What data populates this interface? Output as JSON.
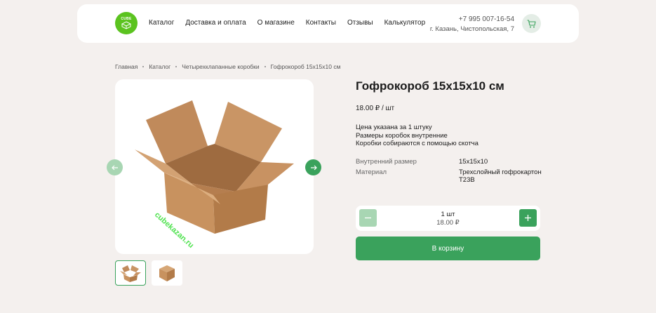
{
  "header": {
    "logo_text": "CUBE",
    "nav": [
      "Каталог",
      "Доставка и оплата",
      "О магазине",
      "Контакты",
      "Отзывы",
      "Калькулятор"
    ],
    "phone": "+7 995 007-16-54",
    "address": "г. Казань, Чистопольская, 7"
  },
  "breadcrumb": [
    "Главная",
    "Каталог",
    "Четырехклапанные коробки",
    "Гофрокороб 15х15х10 см"
  ],
  "product": {
    "title": "Гофрокороб 15х15х10 см",
    "price": "18.00 ₽ / шт",
    "description": [
      "Цена указана за 1 штуку",
      "Размеры коробок внутренние",
      "Коробки собираются с помощью скотча"
    ],
    "specs": [
      {
        "label": "Внутренний размер",
        "value": "15х15х10"
      },
      {
        "label": "Материал",
        "value": "Трехслойный гофрокартон Т23В"
      }
    ],
    "watermark": "cubekazan.ru"
  },
  "quantity": {
    "count": "1 шт",
    "sum": "18.00 ₽"
  },
  "add_to_cart_label": "В корзину",
  "colors": {
    "accent": "#3aa25c",
    "accent_light": "#a8d6b3",
    "logo": "#5bc31f",
    "background": "#f4f0ee"
  }
}
